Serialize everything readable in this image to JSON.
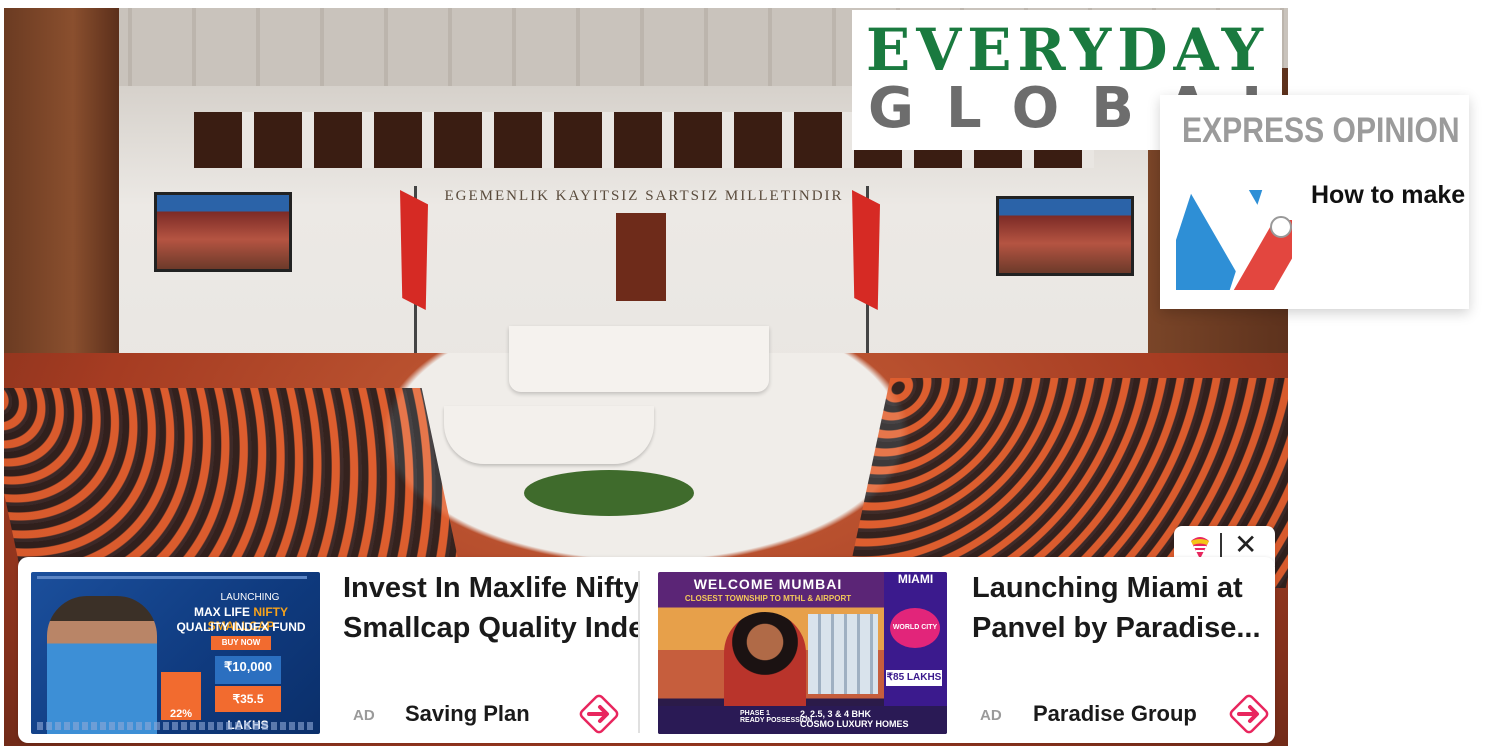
{
  "logo": {
    "line1": "EVERYDAY",
    "line2": "GLOBAL",
    "green": "#1a7a3f",
    "gray": "#6d6d6d"
  },
  "hero": {
    "motto": "EGEMENLIK KAYITSIZ SARTSIZ MILLETINDIR"
  },
  "opinion": {
    "title": "EXPRESS OPINION",
    "headline": "How to make"
  },
  "ads": {
    "controls": {
      "close_glyph": "✕"
    },
    "items": [
      {
        "title_line1": "Invest In Maxlife Nifty",
        "title_line2": "Smallcap Quality Index",
        "label": "AD",
        "sponsor": "Saving Plan",
        "creative": {
          "launching": "LAUNCHING",
          "fund_a": "MAX LIFE",
          "fund_b": "NIFTY SMALLCAP",
          "fund_c": "QUALITY INDEX FUND",
          "buy": "BUY NOW",
          "pct": "22%",
          "amt1": "₹10,000",
          "amt2": "₹35.5 LAKHS"
        }
      },
      {
        "title_line1": "Launching Miami at",
        "title_line2": "Panvel by Paradise...",
        "label": "AD",
        "sponsor": "Paradise Group",
        "creative": {
          "welcome": "WELCOME MUMBAI",
          "sub": "CLOSEST TOWNSHIP TO MTHL & AIRPORT",
          "miami": "MIAMI",
          "world": "WORLD CITY",
          "price": "₹85 LAKHS",
          "phase": "PHASE 1",
          "possession": "READY POSSESSION",
          "bhk": "2, 2.5, 3 & 4 BHK",
          "homes": "COSMO LUXURY HOMES"
        }
      }
    ],
    "accent": "#e8265e"
  }
}
